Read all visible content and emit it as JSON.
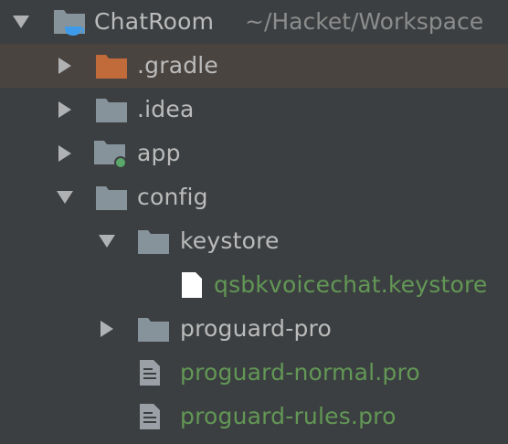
{
  "tree": {
    "root": {
      "label": "ChatRoom",
      "path": "~/Hacket/Workspace",
      "icon": "project-folder-icon",
      "expanded": true
    },
    "items": [
      {
        "label": ".gradle",
        "icon": "folder-icon",
        "color": "#c26b3a",
        "expanded": false,
        "selected": true
      },
      {
        "label": ".idea",
        "icon": "folder-icon",
        "color": "#87939a",
        "expanded": false
      },
      {
        "label": "app",
        "icon": "module-folder-icon",
        "color": "#87939a",
        "expanded": false
      },
      {
        "label": "config",
        "icon": "folder-icon",
        "color": "#87939a",
        "expanded": true
      },
      {
        "label": "keystore",
        "icon": "folder-icon",
        "color": "#87939a",
        "expanded": true
      },
      {
        "label": "qsbkvoicechat.keystore",
        "icon": "file-icon",
        "text_color": "#629755"
      },
      {
        "label": "proguard-pro",
        "icon": "folder-icon",
        "color": "#87939a",
        "expanded": false
      },
      {
        "label": "proguard-normal.pro",
        "icon": "text-file-icon",
        "text_color": "#629755"
      },
      {
        "label": "proguard-rules.pro",
        "icon": "text-file-icon",
        "text_color": "#629755"
      }
    ]
  },
  "colors": {
    "background": "#3c3f41",
    "selection": "#4a4440",
    "text": "#bbbbbb",
    "vcs_added": "#629755",
    "folder": "#87939a",
    "excluded_folder": "#c26b3a",
    "module_dot": "#59a869",
    "cup": "#3d9be9"
  }
}
